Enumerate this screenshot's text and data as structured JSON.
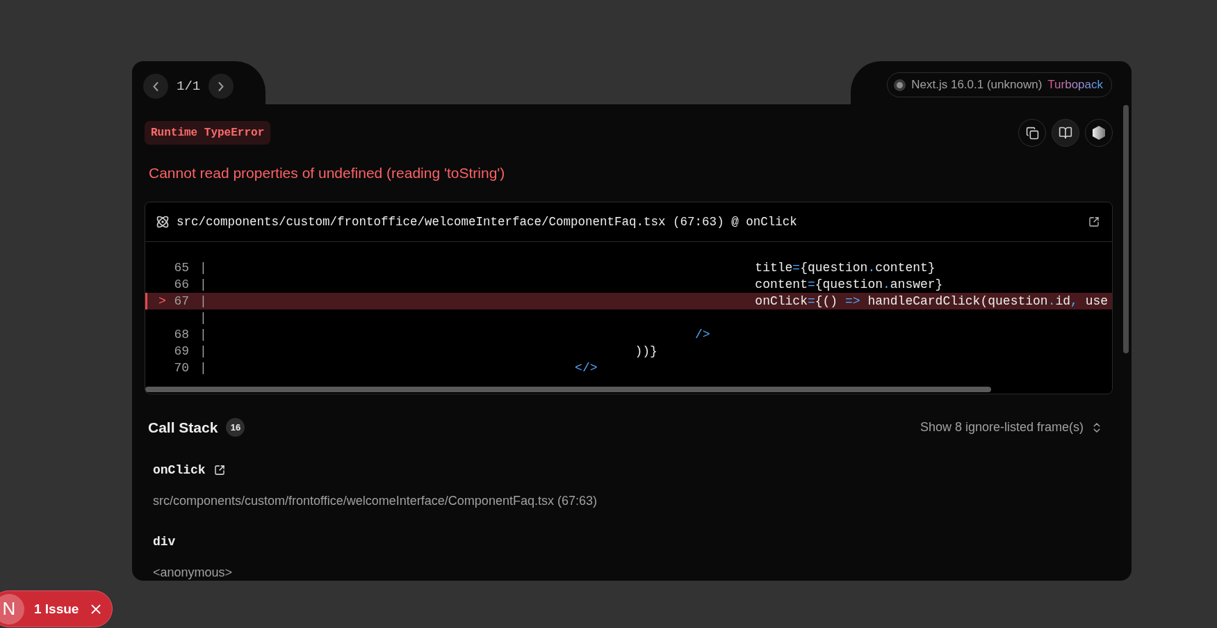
{
  "pager": {
    "position": "1/1"
  },
  "version_badge": {
    "label": "Next.js 16.0.1 (unknown)",
    "bundler": "Turbopack"
  },
  "error": {
    "type": "Runtime TypeError",
    "message": "Cannot read properties of undefined (reading 'toString')"
  },
  "code_frame": {
    "file": "src/components/custom/frontoffice/welcomeInterface/ComponentFaq.tsx (67:63) @ onClick",
    "lines": [
      {
        "number": "65",
        "gutter": "|",
        "highlighted": false,
        "code": [
          {
            "text": "                                                                         title"
          },
          {
            "text": "=",
            "kind": "punct"
          },
          {
            "text": "{question"
          },
          {
            "text": ".",
            "kind": "punct"
          },
          {
            "text": "content}"
          }
        ]
      },
      {
        "number": "66",
        "gutter": "|",
        "highlighted": false,
        "code": [
          {
            "text": "                                                                         content"
          },
          {
            "text": "=",
            "kind": "punct"
          },
          {
            "text": "{question"
          },
          {
            "text": ".",
            "kind": "punct"
          },
          {
            "text": "answer}"
          }
        ]
      },
      {
        "marker": ">",
        "number": "67",
        "gutter": "|",
        "highlighted": true,
        "code": [
          {
            "text": "                                                                         onClick"
          },
          {
            "text": "=",
            "kind": "punct"
          },
          {
            "text": "{() "
          },
          {
            "text": "=>",
            "kind": "punct"
          },
          {
            "text": " handleCardClick(question"
          },
          {
            "text": ".",
            "kind": "punct"
          },
          {
            "text": "id"
          },
          {
            "text": ",",
            "kind": "punct"
          },
          {
            "text": " use"
          }
        ]
      },
      {
        "gutter": "|",
        "highlighted": false
      },
      {
        "number": "68",
        "gutter": "|",
        "highlighted": false,
        "code": [
          {
            "text": "                                                                 />",
            "kind": "punct"
          }
        ]
      },
      {
        "number": "69",
        "gutter": "|",
        "highlighted": false,
        "code": [
          {
            "text": "                                                         ))}"
          }
        ]
      },
      {
        "number": "70",
        "gutter": "|",
        "highlighted": false,
        "code": [
          {
            "text": "                                                 </>",
            "kind": "punct"
          }
        ]
      }
    ]
  },
  "call_stack": {
    "title": "Call Stack",
    "count": "16",
    "toggle": "Show 8 ignore-listed frame(s)",
    "frames": [
      {
        "name": "onClick",
        "location": "src/components/custom/frontoffice/welcomeInterface/ComponentFaq.tsx (67:63)",
        "external_link": true
      },
      {
        "name": "div",
        "location": "<anonymous>",
        "external_link": false
      }
    ]
  },
  "issue_badge": {
    "logo": "N",
    "label": "1 Issue"
  }
}
